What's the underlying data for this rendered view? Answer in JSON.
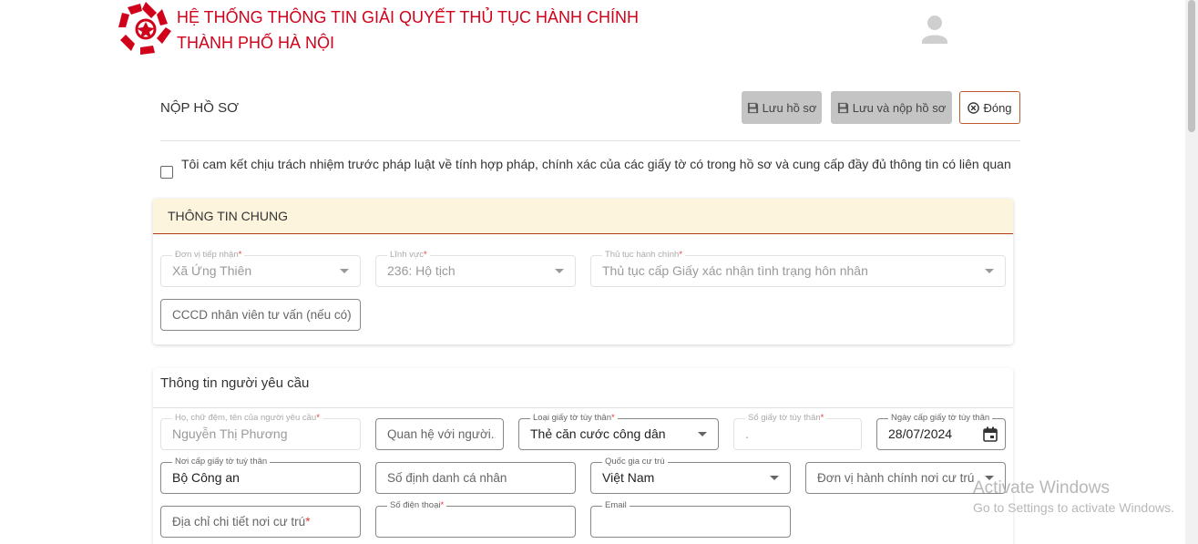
{
  "header": {
    "title_line1": "HỆ THỐNG THÔNG TIN GIẢI QUYẾT THỦ TỤC HÀNH CHÍNH",
    "title_line2": "THÀNH PHỐ HÀ NỘI",
    "logo_icon": "hanoi-logo-icon",
    "avatar_icon": "user-avatar-icon",
    "brand_color": "#d0021b"
  },
  "toolbar": {
    "page_title": "NỘP HỒ SƠ",
    "save_label": "Lưu hồ sơ",
    "save_submit_label": "Lưu và nộp hồ sơ",
    "close_label": "Đóng"
  },
  "commitment": {
    "text": "Tôi cam kết chịu trách nhiệm trước pháp luật về tính hợp pháp, chính xác của các giấy tờ có trong hồ sơ và cung cấp đầy đủ thông tin có liên quan",
    "checked": false
  },
  "general_info": {
    "title": "THÔNG TIN CHUNG",
    "receiving_unit": {
      "label": "Đơn vị tiếp nhận",
      "value": "Xã Ứng Thiên"
    },
    "field_area": {
      "label": "Lĩnh vực",
      "value": "236: Hộ tịch"
    },
    "procedure": {
      "label": "Thủ tục hành chính",
      "value": "Thủ tục cấp Giấy xác nhận tình trạng hôn nhân"
    },
    "consultant_id": {
      "placeholder": "CCCD nhân viên tư vấn (nếu có)"
    }
  },
  "requester": {
    "title": "Thông tin người yêu cầu",
    "full_name": {
      "label": "Họ, chữ đệm, tên của người yêu cầu",
      "value": "Nguyễn Thị Phương"
    },
    "relationship": {
      "placeholder": "Quan hệ với người..."
    },
    "id_type": {
      "label": "Loại giấy tờ tùy thân",
      "value": "Thẻ căn cước công dân"
    },
    "id_number": {
      "label": "Số giấy tờ tùy thân",
      "value": "."
    },
    "issue_date": {
      "label": "Ngày cấp giấy tờ tùy thân",
      "value": "28/07/2024"
    },
    "issue_place": {
      "label": "Nơi cấp giấy tờ tuỳ thân",
      "value": "Bộ Công an"
    },
    "personal_id": {
      "placeholder": "Số định danh cá nhân"
    },
    "country": {
      "label": "Quốc gia cư trú",
      "value": "Việt Nam"
    },
    "admin_unit": {
      "placeholder": "Đơn vị hành chính nơi cư trú"
    },
    "address": {
      "placeholder": "Địa chỉ chi tiết nơi cư trú"
    },
    "phone": {
      "label": "Số điện thoại",
      "value": ""
    },
    "email": {
      "label": "Email",
      "value": ""
    }
  },
  "watermark": {
    "line1": "Activate Windows",
    "line2": "Go to Settings to activate Windows."
  }
}
